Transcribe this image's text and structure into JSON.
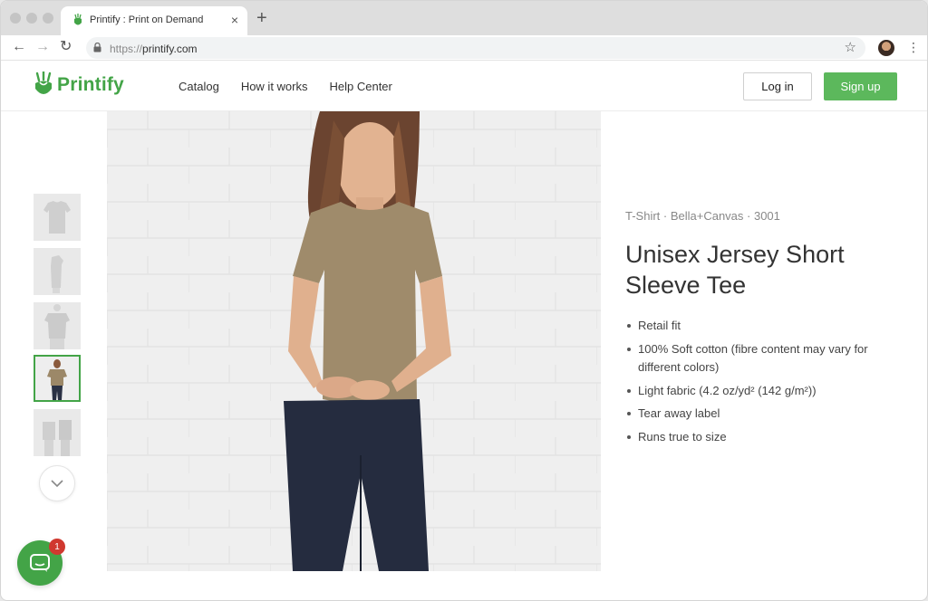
{
  "browser": {
    "tab_title": "Printify : Print on Demand",
    "tab_close": "×",
    "new_tab": "+",
    "url_scheme": "https://",
    "url_host": "printify.com",
    "back": "←",
    "forward": "→",
    "reload": "↻",
    "star": "☆",
    "menu": "⋮"
  },
  "header": {
    "brand": "Printify",
    "nav": [
      "Catalog",
      "How it works",
      "Help Center"
    ],
    "login_label": "Log in",
    "signup_label": "Sign up"
  },
  "colors": {
    "brand_green": "#43a447",
    "signup_green": "#5cb85c",
    "badge_red": "#d0382f"
  },
  "product": {
    "meta": "T-Shirt · Bella+Canvas · 3001",
    "title": "Unisex Jersey Short Sleeve Tee",
    "features": [
      "Retail fit",
      "100% Soft cotton (fibre content may vary for different colors)",
      "Light fabric (4.2 oz/yd² (142 g/m²))",
      "Tear away label",
      "Runs true to size"
    ]
  },
  "gallery": {
    "thumb_count": 5,
    "active_index": 3,
    "down_icon": "chevron-down-icon"
  },
  "chat": {
    "badge_count": "1"
  }
}
